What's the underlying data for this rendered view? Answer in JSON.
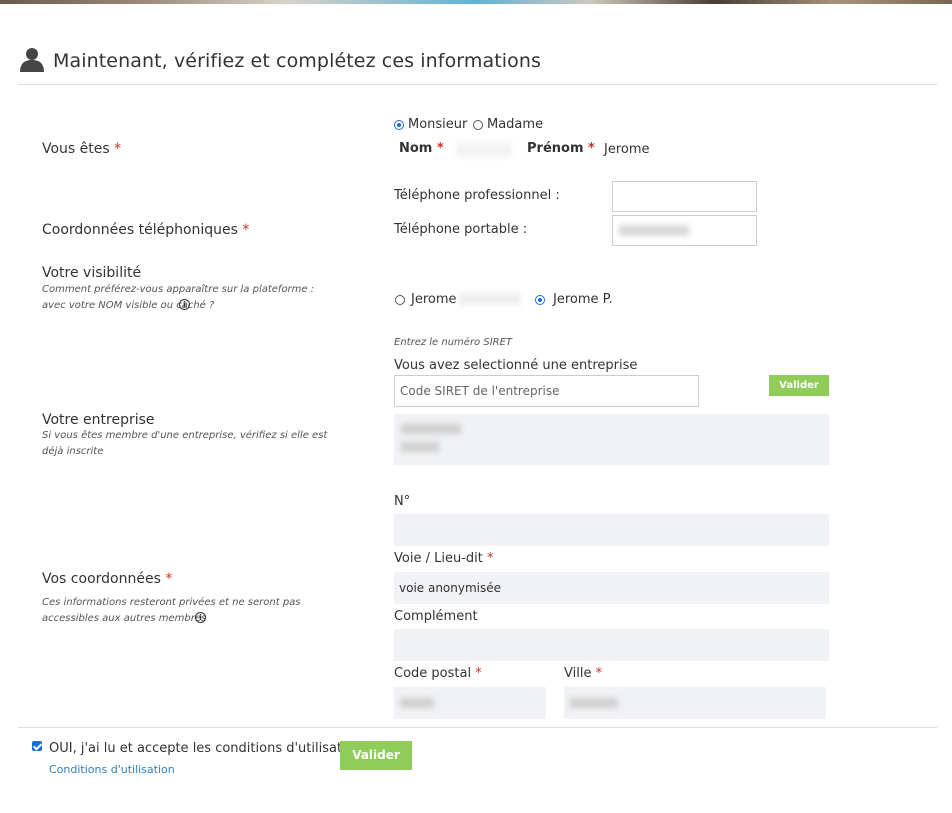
{
  "header": {
    "title": "Maintenant, vérifiez et complétez ces informations",
    "icon": "user-icon"
  },
  "civility": {
    "label": "Vous êtes",
    "required": "*",
    "options": [
      "Monsieur",
      "Madame"
    ],
    "selected": "Monsieur",
    "nom_label": "Nom",
    "prenom_label": "Prénom",
    "prenom_value": "Jerome"
  },
  "phones": {
    "label": "Coordonnées téléphoniques",
    "required": "*",
    "pro_label": "Téléphone professionnel :",
    "mobile_label": "Téléphone portable :"
  },
  "visibility": {
    "label": "Votre visibilité",
    "help": "Comment préférez-vous apparaître sur la plateforme : avec votre NOM visible ou caché ?",
    "option_full": "Jerome",
    "option_short": "Jerome P.",
    "selected": "Jerome P."
  },
  "company": {
    "label": "Votre entreprise",
    "help": "Si vous êtes membre d'une entreprise, vérifiez si elle est déjà inscrite",
    "siret_hint": "Entrez le numéro SIRET",
    "selected_text": "Vous avez selectionné une entreprise",
    "siret_placeholder": "Code SIRET de l'entreprise",
    "validate_label": "Valider"
  },
  "address": {
    "label": "Vos coordonnées",
    "required": "*",
    "help": "Ces informations resteront privées et ne seront pas accessibles aux autres membres",
    "numero_label": "N°",
    "voie_label": "Voie / Lieu-dit",
    "voie_value": "voie anonymisée",
    "complement_label": "Complément",
    "cp_label": "Code postal",
    "ville_label": "Ville"
  },
  "footer": {
    "accept_text": "OUI, j'ai lu et accepte les conditions d'utilisation",
    "terms_link": "Conditions d'utilisation",
    "submit_label": "Valider",
    "accepted": true
  },
  "colors": {
    "accent": "#8fcc5a",
    "required": "#d0311f",
    "link": "#2d7fbf",
    "radio": "#1a6fd6"
  }
}
